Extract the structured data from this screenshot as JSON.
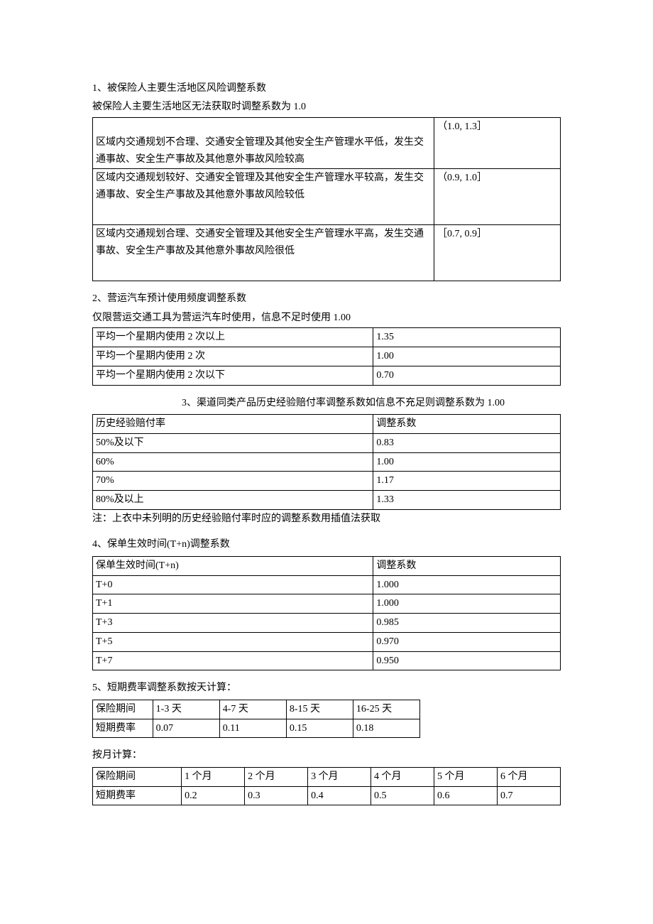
{
  "section1": {
    "title": "1、被保险人主要生活地区风险调整系数",
    "subtitle": "被保险人主要生活地区无法获取时调整系数为 1.0",
    "rows": [
      {
        "desc": "区域内交通规划不合理、交通安全管理及其他安全生产管理水平低，发生交通事故、安全生产事故及其他意外事故风险较高",
        "value": "（1.0, 1.3］"
      },
      {
        "desc": "区域内交通规划较好、交通安全管理及其他安全生产管理水平较高，发生交通事故、安全生产事故及其他意外事故风险较低",
        "value": "（0.9, 1.0］"
      },
      {
        "desc": "区域内交通规划合理、交通安全管理及其他安全生产管理水平高，发生交通事故、安全生产事故及其他意外事故风险很低",
        "value": "［0.7, 0.9］"
      }
    ]
  },
  "section2": {
    "title": "2、营运汽车预计使用频度调整系数",
    "subtitle": "仅限营运交通工具为营运汽车时使用，信息不足时使用 1.00",
    "rows": [
      {
        "desc": "平均一个星期内使用 2 次以上",
        "value": "1.35"
      },
      {
        "desc": "平均一个星期内使用 2 次",
        "value": "1.00"
      },
      {
        "desc": "平均一个星期内使用 2 次以下",
        "value": "0.70"
      }
    ]
  },
  "section3": {
    "title": "3、渠道同类产品历史经验赔付率调整系数如信息不充足则调整系数为 1.00",
    "header": {
      "col1": "历史经验赔付率",
      "col2": "调整系数"
    },
    "rows": [
      {
        "col1": "50%及以下",
        "col2": "0.83"
      },
      {
        "col1": "60%",
        "col2": "1.00"
      },
      {
        "col1": "70%",
        "col2": "1.17"
      },
      {
        "col1": "80%及以上",
        "col2": "1.33"
      }
    ],
    "note": "注：上衣中未列明的历史经验赔付率时应的调整系数用插值法获取"
  },
  "section4": {
    "title": "4、保单生效时间(T+n)调整系数",
    "header": {
      "col1": "保单生效时间(T+n)",
      "col2": "调整系数"
    },
    "rows": [
      {
        "col1": "T+0",
        "col2": "1.000"
      },
      {
        "col1": "T+1",
        "col2": "1.000"
      },
      {
        "col1": "T+3",
        "col2": "0.985"
      },
      {
        "col1": "T+5",
        "col2": "0.970"
      },
      {
        "col1": "T+7",
        "col2": "0.950"
      }
    ]
  },
  "section5": {
    "title": "5、短期费率调整系数按天计算：",
    "header": [
      "保险期间",
      "1-3 天",
      "4-7 天",
      "8-15 天",
      "16-25 天"
    ],
    "row": [
      "短期费率",
      "0.07",
      "0.11",
      "0.15",
      "0.18"
    ]
  },
  "section6": {
    "title": "按月计算：",
    "header": [
      "保险期间",
      "1 个月",
      "2 个月",
      "3 个月",
      "4 个月",
      "5 个月",
      "6 个月"
    ],
    "row": [
      "短期费率",
      "0.2",
      "0.3",
      "0.4",
      "0.5",
      "0.6",
      "0.7"
    ]
  },
  "chart_data": [
    {
      "type": "table",
      "title": "被保险人主要生活地区风险调整系数",
      "categories": [
        "风险较高",
        "风险较低",
        "风险很低"
      ],
      "values": [
        "(1.0, 1.3]",
        "(0.9, 1.0]",
        "[0.7, 0.9]"
      ]
    },
    {
      "type": "table",
      "title": "营运汽车预计使用频度调整系数",
      "categories": [
        "平均一个星期内使用 2 次以上",
        "平均一个星期内使用 2 次",
        "平均一个星期内使用 2 次以下"
      ],
      "values": [
        1.35,
        1.0,
        0.7
      ]
    },
    {
      "type": "table",
      "title": "渠道同类产品历史经验赔付率调整系数",
      "categories": [
        "50%及以下",
        "60%",
        "70%",
        "80%及以上"
      ],
      "values": [
        0.83,
        1.0,
        1.17,
        1.33
      ]
    },
    {
      "type": "table",
      "title": "保单生效时间(T+n)调整系数",
      "categories": [
        "T+0",
        "T+1",
        "T+3",
        "T+5",
        "T+7"
      ],
      "values": [
        1.0,
        1.0,
        0.985,
        0.97,
        0.95
      ]
    },
    {
      "type": "table",
      "title": "短期费率调整系数按天计算",
      "categories": [
        "1-3 天",
        "4-7 天",
        "8-15 天",
        "16-25 天"
      ],
      "values": [
        0.07,
        0.11,
        0.15,
        0.18
      ]
    },
    {
      "type": "table",
      "title": "短期费率调整系数按月计算",
      "categories": [
        "1 个月",
        "2 个月",
        "3 个月",
        "4 个月",
        "5 个月",
        "6 个月"
      ],
      "values": [
        0.2,
        0.3,
        0.4,
        0.5,
        0.6,
        0.7
      ]
    }
  ]
}
